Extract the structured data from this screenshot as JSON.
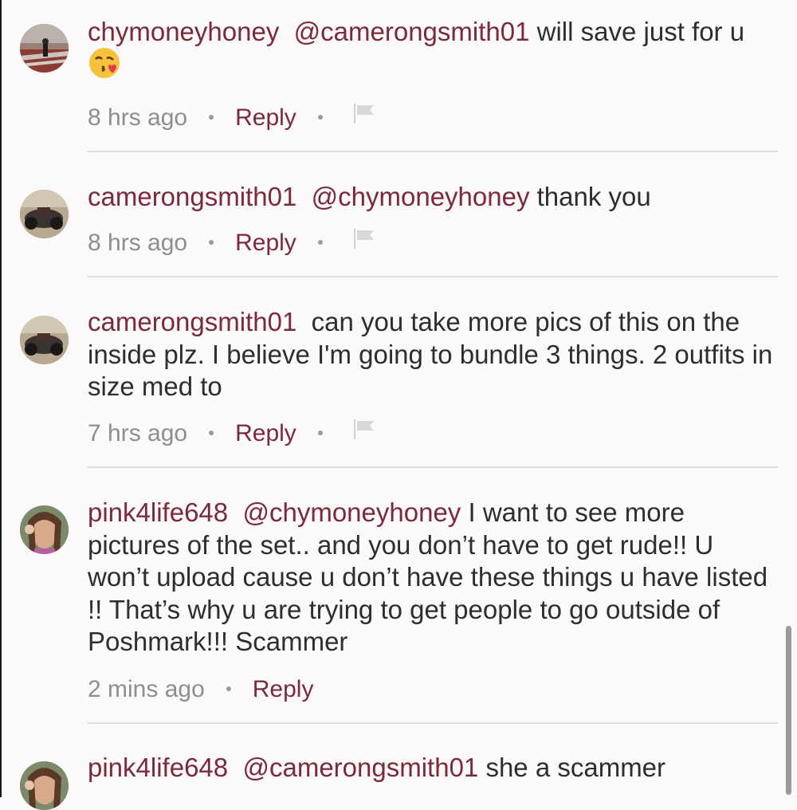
{
  "comments": [
    {
      "user": "chymoneyhoney",
      "mention": "@camerongsmith01",
      "text": "will save just for u",
      "emoji_icon": "kissing-face-with-heart-emoji",
      "time": "8 hrs ago",
      "reply": "Reply"
    },
    {
      "user": "camerongsmith01",
      "mention": "@chymoneyhoney",
      "text": "thank you",
      "time": "8 hrs ago",
      "reply": "Reply"
    },
    {
      "user": "camerongsmith01",
      "mention": "",
      "text": "can you take more pics of this on the inside plz. I believe I'm going to bundle 3 things. 2 outfits in size med to",
      "time": "7 hrs ago",
      "reply": "Reply"
    },
    {
      "user": "pink4life648",
      "mention": "@chymoneyhoney",
      "text": "I want to see more pictures of the set.. and you don’t have to get rude!! U won’t upload cause u don’t have these things u have listed !! That’s why u are trying to get people to go outside of Poshmark!!!  Scammer",
      "time": "2 mins ago",
      "reply": "Reply"
    },
    {
      "user": "pink4life648",
      "mention": "@camerongsmith01",
      "text": "she a scammer"
    }
  ],
  "colors": {
    "username": "#7b2a3a",
    "reply": "#7b2a3a",
    "timestamp": "#8e8e8e",
    "background": "#fbf9fa",
    "divider": "#dcdcdc"
  },
  "icons": [
    "flag-icon",
    "avatar"
  ]
}
